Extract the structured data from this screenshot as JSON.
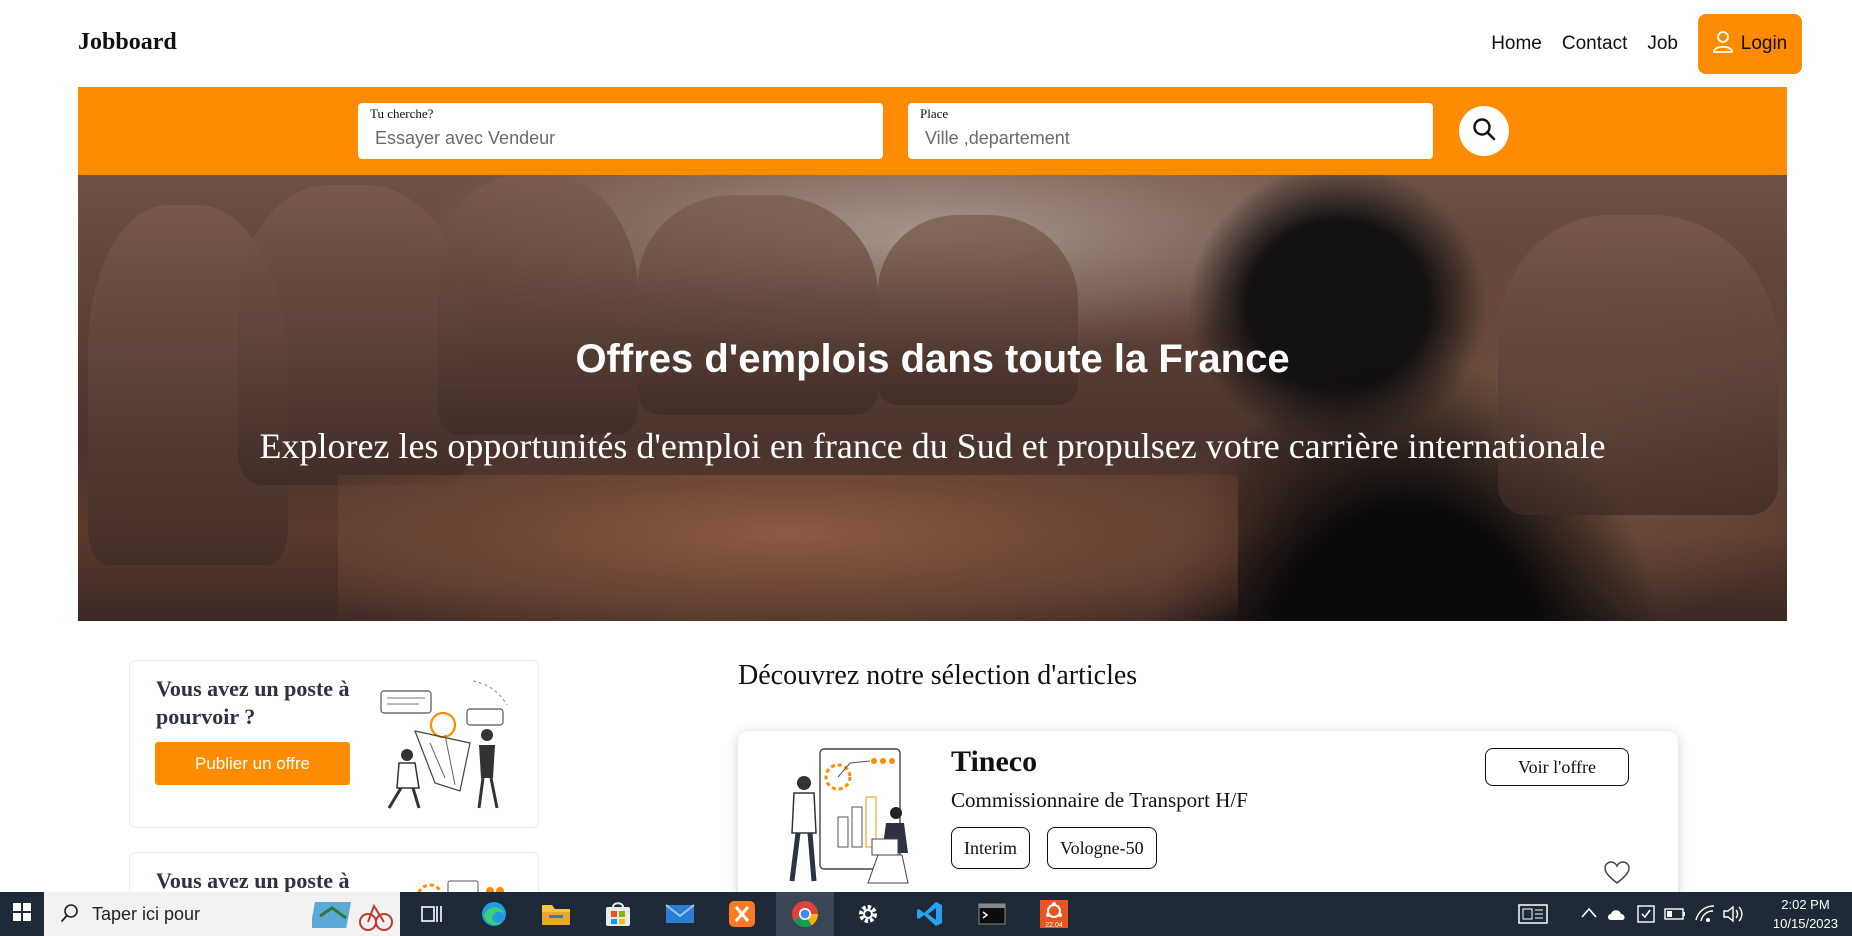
{
  "header": {
    "brand": "Jobboard",
    "nav": [
      "Home",
      "Contact",
      "Job"
    ],
    "login_label": "Login",
    "accent_color": "#ff8c00"
  },
  "search": {
    "what_label": "Tu cherche?",
    "what_placeholder": "Essayer avec Vendeur",
    "where_label": "Place",
    "where_placeholder": "Ville ,departement",
    "button_icon": "search-icon"
  },
  "hero": {
    "title": "Offres d'emplois dans toute la France",
    "subtitle": "Explorez les opportunités d'emploi en france du Sud et propulsez votre carrière internationale"
  },
  "sidebar_cards": [
    {
      "title": "Vous avez un poste à pourvoir ?",
      "button": "Publier un offre"
    },
    {
      "title": "Vous avez un poste à"
    }
  ],
  "articles": {
    "section_title": "Découvrez notre sélection d'articles",
    "jobs": [
      {
        "company": "Tineco",
        "title": "Commissionnaire de Transport H/F",
        "tags": [
          "Interim",
          "Vologne-50"
        ],
        "offer_button": "Voir l'offre"
      }
    ]
  },
  "taskbar": {
    "search_placeholder": "Taper ici pour",
    "time": "2:02 PM",
    "date": "10/15/2023",
    "ubuntu_badge": "22.04"
  }
}
